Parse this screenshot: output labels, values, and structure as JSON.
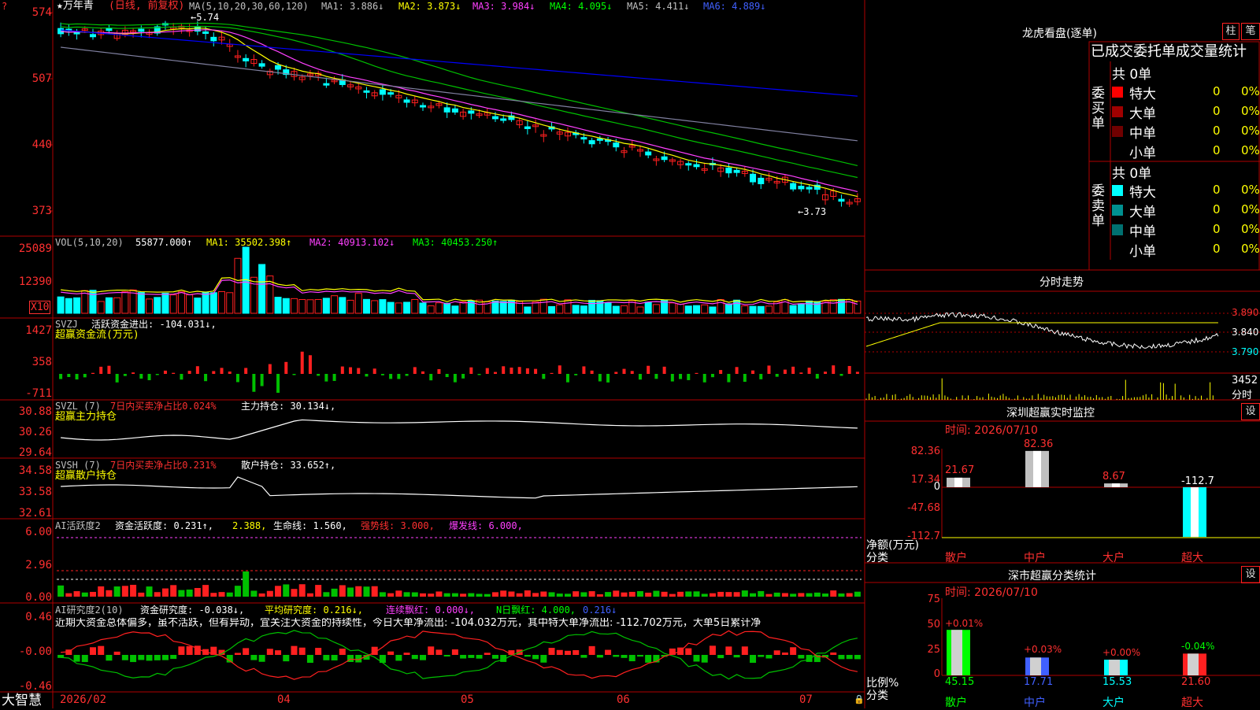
{
  "colors": {
    "up": "#ff2020",
    "down": "#00ffff",
    "ma1": "#ffff00",
    "ma2": "#ff40ff",
    "ma3": "#00c000",
    "ma4": "#ffffff",
    "ma5": "#8080a0",
    "ma6": "#0000ff",
    "grid": "#b00000"
  },
  "main": {
    "stock": "万年青",
    "period": "(日线, 前复权)",
    "ma_label": "MA(5,10,20,30,60,120)",
    "ma1": "MA1: 3.886↓",
    "ma2": "MA2: 3.873↓",
    "ma3": "MA3: 3.984↓",
    "ma4": "MA4: 4.095↓",
    "ma5": "MA5: 4.411↓",
    "ma6": "MA6: 4.889↓",
    "high_mark": "5.74",
    "low_mark": "←3.73",
    "y_ticks": [
      "574",
      "507",
      "440",
      "373"
    ]
  },
  "vol": {
    "label": "VOL(5,10,20)",
    "value": "55877.000↑",
    "ma1": "MA1: 35502.398↑",
    "ma2": "MA2: 40913.102↓",
    "ma3": "MA3: 40453.250↑",
    "y_ticks": [
      "25089",
      "12390",
      "X10"
    ]
  },
  "svzj": {
    "label": "SVZJ",
    "text": "活跃资金进出: -104.031↓,",
    "sub": "超赢资金流(万元)",
    "y_ticks": [
      "1427",
      "358",
      "-711"
    ]
  },
  "svzl": {
    "label": "SVZL (7)",
    "ratio": "7日内买卖净占比0.024%",
    "hold": "主力持仓: 30.134↓,",
    "sub": "超赢主力持仓",
    "y_ticks": [
      "30.88",
      "30.26",
      "29.64"
    ]
  },
  "svsh": {
    "label": "SVSH (7)",
    "ratio": "7日内买卖净占比0.231%",
    "hold": "散户持仓: 33.652↑,",
    "sub": "超赢散户持仓",
    "y_ticks": [
      "34.58",
      "33.58",
      "32.61"
    ]
  },
  "ai1": {
    "label": "AI活跃度2",
    "active": "资金活跃度: 0.231↑,",
    "v2": "2.388,",
    "life": "生命线: 1.560,",
    "strong": "强势线: 3.000,",
    "burst": "爆发线: 6.000,",
    "y_ticks": [
      "6.00",
      "2.96",
      "0.00"
    ]
  },
  "ai2": {
    "label": "AI研究度2(10)",
    "research": "资金研究度: -0.038↓,",
    "avg": "平均研究度: 0.216↓,",
    "red": "连续飘红: 0.000↓,",
    "nday": "N日飘红: 4.000,",
    "v5": "0.216↓",
    "comment": "近期大资金总体偏多，虽不活跃，但有异动，宜关注大资金的持续性，今日大单净流出: -104.032万元，其中特大单净流出: -112.702万元，大单5日累计净",
    "y_ticks": [
      "0.46",
      "-0.00",
      "-0.46"
    ]
  },
  "bottom": {
    "brand": "大智慧",
    "dates": [
      "2026/02",
      "04",
      "05",
      "06",
      "07"
    ]
  },
  "right": {
    "lhb_title": "龙虎看盘(逐单)",
    "btn_zhu": "柱",
    "btn_bi": "笔",
    "tabs": "已成交委托单成交量统计",
    "buy_label": "委买单",
    "sell_label": "委卖单",
    "buy_total": "共 0单",
    "sell_total": "共 0单",
    "buy_rows": [
      {
        "name": "特大",
        "n": "0",
        "p": "0%"
      },
      {
        "name": "大单",
        "n": "0",
        "p": "0%"
      },
      {
        "name": "中单",
        "n": "0",
        "p": "0%"
      },
      {
        "name": "小单",
        "n": "0",
        "p": "0%"
      }
    ],
    "sell_rows": [
      {
        "name": "特大",
        "n": "0",
        "p": "0%"
      },
      {
        "name": "大单",
        "n": "0",
        "p": "0%"
      },
      {
        "name": "中单",
        "n": "0",
        "p": "0%"
      },
      {
        "name": "小单",
        "n": "0",
        "p": "0%"
      }
    ],
    "intraday_title": "分时走势",
    "intraday_prices": [
      "3.890",
      "3.840",
      "3.790"
    ],
    "intraday_vol": "3452",
    "intraday_vol_label": "分时",
    "monitor_title": "深圳超赢实时监控",
    "monitor_set": "设",
    "monitor_time": "时间: 2026/07/10",
    "monitor_y": [
      "82.36",
      "17.34",
      "0",
      "-47.68",
      "-112.7"
    ],
    "monitor_unit": "净额(万元)",
    "monitor_cat": "分类",
    "monitor_bars": [
      {
        "name": "散户",
        "val": "21.67"
      },
      {
        "name": "中户",
        "val": "82.36"
      },
      {
        "name": "大户",
        "val": "8.67"
      },
      {
        "name": "超大",
        "val": "-112.7"
      }
    ],
    "stat_title": "深市超赢分类统计",
    "stat_set": "设",
    "stat_time": "时间: 2026/07/10",
    "stat_y": [
      "75",
      "50",
      "25",
      "0"
    ],
    "stat_unit": "比例%",
    "stat_cat": "分类",
    "stat_bars": [
      {
        "name": "散户",
        "val": "45.15",
        "chg": "+0.01%"
      },
      {
        "name": "中户",
        "val": "17.71",
        "chg": "+0.03%"
      },
      {
        "name": "大户",
        "val": "15.53",
        "chg": "+0.00%"
      },
      {
        "name": "超大",
        "val": "21.60",
        "chg": "-0.04%"
      }
    ]
  }
}
